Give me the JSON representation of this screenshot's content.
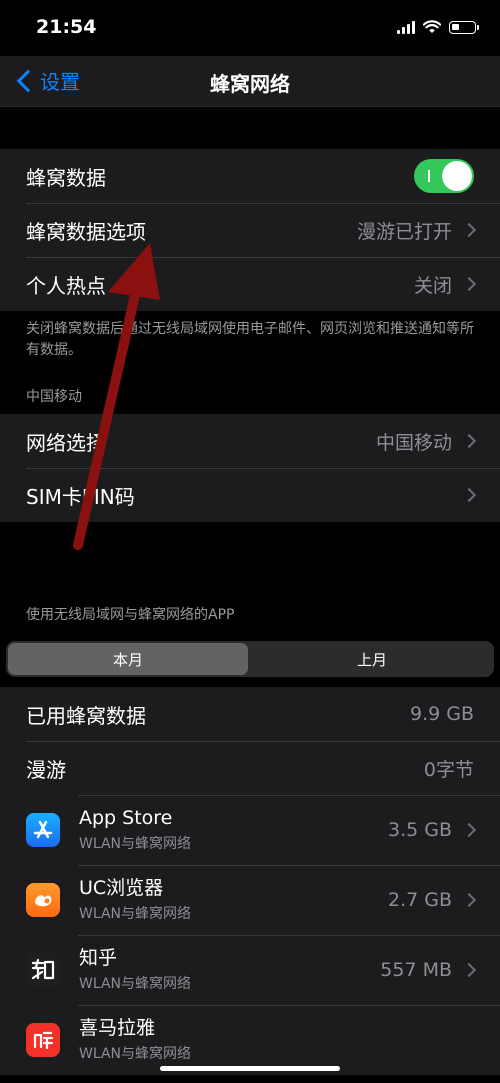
{
  "status": {
    "time": "21:54"
  },
  "nav": {
    "back_label": "设置",
    "title": "蜂窝网络"
  },
  "cellular_group": {
    "data_label": "蜂窝数据",
    "data_toggle": "on",
    "options_label": "蜂窝数据选项",
    "options_value": "漫游已打开",
    "hotspot_label": "个人热点",
    "hotspot_value": "关闭"
  },
  "footnote": "关闭蜂窝数据后通过无线局域网使用电子邮件、网页浏览和推送通知等所有数据。",
  "carrier_header": "中国移动",
  "carrier_group": {
    "network_label": "网络选择",
    "network_value": "中国移动",
    "sim_label": "SIM卡PIN码"
  },
  "apps_header": "使用无线局域网与蜂窝网络的APP",
  "segments": {
    "current": "本月",
    "previous": "上月"
  },
  "usage": {
    "used_label": "已用蜂窝数据",
    "used_value": "9.9 GB",
    "roaming_label": "漫游",
    "roaming_value": "0字节"
  },
  "apps": [
    {
      "name": "App Store",
      "sub": "WLAN与蜂窝网络",
      "usage": "3.5 GB",
      "icon": "app-store-icon",
      "color": "#1a8cff"
    },
    {
      "name": "UC浏览器",
      "sub": "WLAN与蜂窝网络",
      "usage": "2.7 GB",
      "icon": "uc-browser-icon",
      "color": "#ff7a1a"
    },
    {
      "name": "知乎",
      "sub": "WLAN与蜂窝网络",
      "usage": "557 MB",
      "icon": "zhihu-icon",
      "color": "#1f1f1f"
    },
    {
      "name": "喜马拉雅",
      "sub": "WLAN与蜂窝网络",
      "usage": "",
      "icon": "ximalaya-icon",
      "color": "#f2322a"
    }
  ],
  "annotation": {
    "arrow_color": "#8b1010"
  }
}
